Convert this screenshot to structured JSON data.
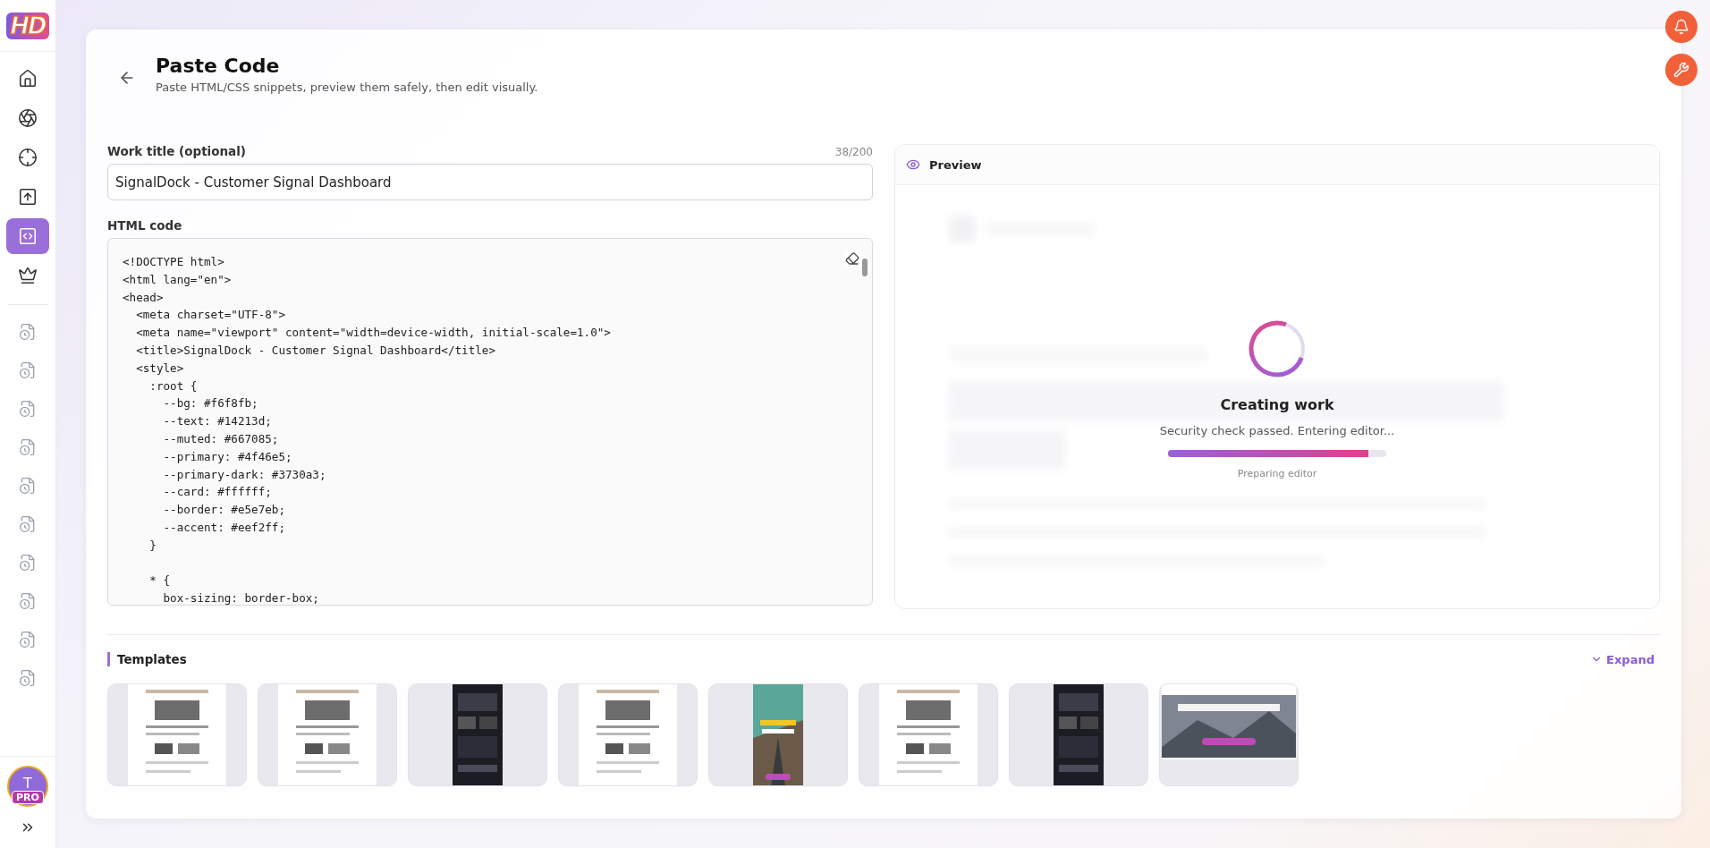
{
  "sidebar": {
    "logo": "HD",
    "nav": [
      {
        "selected": false
      },
      {
        "selected": false
      },
      {
        "selected": false
      },
      {
        "selected": false
      },
      {
        "selected": true
      },
      {
        "selected": false
      }
    ],
    "recent": [
      {
        "kind": "work"
      },
      {
        "kind": "work"
      },
      {
        "kind": "work"
      },
      {
        "kind": "work"
      },
      {
        "kind": "work"
      },
      {
        "kind": "work"
      },
      {
        "kind": "work"
      },
      {
        "kind": "work"
      },
      {
        "kind": "work"
      },
      {
        "kind": "work"
      }
    ],
    "avatar": {
      "initial": "T",
      "badge": "PRO"
    }
  },
  "header": {
    "title": "Paste Code",
    "subtitle": "Paste HTML/CSS snippets, preview them safely, then edit visually."
  },
  "form": {
    "title_label": "Work title (optional)",
    "counter": "38/200",
    "title_value": "SignalDock - Customer Signal Dashboard",
    "code_label": "HTML code",
    "code": "<!DOCTYPE html>\n<html lang=\"en\">\n<head>\n  <meta charset=\"UTF-8\">\n  <meta name=\"viewport\" content=\"width=device-width, initial-scale=1.0\">\n  <title>SignalDock - Customer Signal Dashboard</title>\n  <style>\n    :root {\n      --bg: #f6f8fb;\n      --text: #14213d;\n      --muted: #667085;\n      --primary: #4f46e5;\n      --primary-dark: #3730a3;\n      --card: #ffffff;\n      --border: #e5e7eb;\n      --accent: #eef2ff;\n    }\n\n    * {\n      box-sizing: border-box;"
  },
  "preview": {
    "title": "Preview",
    "status_title": "Creating work",
    "status_text": "Security check passed. Entering editor...",
    "progress": {
      "level": 0.92
    },
    "step": "Preparing editor"
  },
  "templates": {
    "title": "Templates",
    "expand": "Expand",
    "items": [
      {
        "kind": "light"
      },
      {
        "kind": "light"
      },
      {
        "kind": "dark"
      },
      {
        "kind": "light"
      },
      {
        "kind": "poster"
      },
      {
        "kind": "light"
      },
      {
        "kind": "dark"
      },
      {
        "kind": "banner"
      }
    ]
  }
}
